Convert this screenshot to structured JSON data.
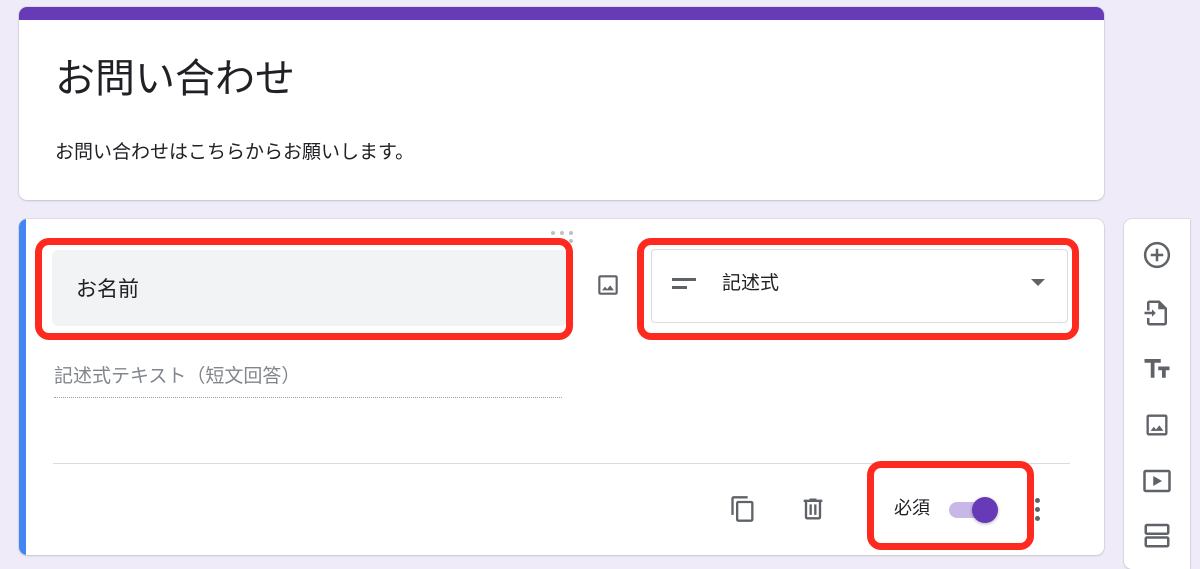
{
  "form": {
    "title": "お問い合わせ",
    "description": "お問い合わせはこちらからお願いします。",
    "accent_color": "#673ab7"
  },
  "question": {
    "title_value": "お名前",
    "type_label": "記述式",
    "answer_placeholder": "記述式テキスト（短文回答）",
    "required_label": "必須",
    "required": true,
    "active_accent_color": "#4285f4"
  },
  "icons": {
    "image": "image-icon",
    "short-answer": "short-answer-lines-icon",
    "dropdown": "chevron-down-icon",
    "copy": "copy-icon",
    "delete": "trash-icon",
    "more": "more-vert-icon",
    "drag": "drag-handle-icon"
  },
  "toolbar": {
    "items": [
      {
        "icon": "add-circle-icon"
      },
      {
        "icon": "import-icon"
      },
      {
        "icon": "text-format-icon"
      },
      {
        "icon": "image-icon"
      },
      {
        "icon": "video-icon"
      },
      {
        "icon": "section-icon"
      }
    ]
  },
  "highlight_color": "#ff2a1f"
}
